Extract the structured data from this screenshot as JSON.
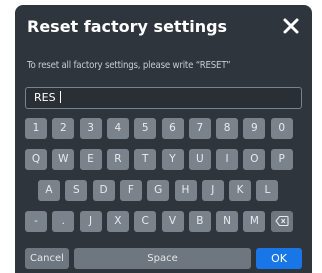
{
  "dialog": {
    "title": "Reset factory settings",
    "instruction": "To reset all factory settings, please write “RESET”",
    "close_icon": "close-icon"
  },
  "input": {
    "value": "RES",
    "has_caret": true
  },
  "keyboard": {
    "rows": [
      [
        "1",
        "2",
        "3",
        "4",
        "5",
        "6",
        "7",
        "8",
        "9",
        "0"
      ],
      [
        "Q",
        "W",
        "E",
        "R",
        "T",
        "Y",
        "U",
        "I",
        "O",
        "P"
      ],
      [
        "A",
        "S",
        "D",
        "F",
        "G",
        "H",
        "J",
        "K",
        "L"
      ],
      [
        "-",
        ".",
        "J",
        "X",
        "C",
        "V",
        "B",
        "N",
        "M"
      ]
    ],
    "backspace_icon": "backspace-icon",
    "cancel_label": "Cancel",
    "space_label": "Space",
    "ok_label": "OK"
  },
  "colors": {
    "dialog_bg": "#2f353d",
    "key_bg": "#7a828c",
    "ok_bg": "#1876e6",
    "text": "#ffffff"
  }
}
